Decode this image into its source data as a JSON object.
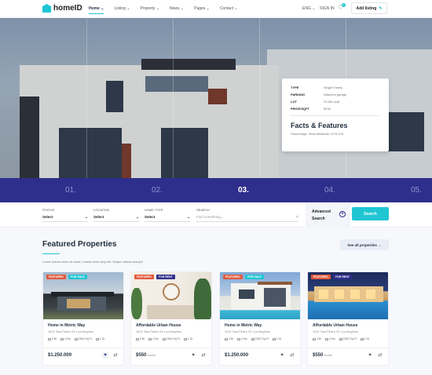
{
  "header": {
    "logo": "homeID",
    "nav": [
      {
        "label": "Home ⌄",
        "active": true
      },
      {
        "label": "Listing ⌄"
      },
      {
        "label": "Property ⌄"
      },
      {
        "label": "News ⌄"
      },
      {
        "label": "Pages ⌄"
      },
      {
        "label": "Contact ⌄"
      }
    ],
    "lang": "ENG ⌄",
    "signin": "SIGN IN",
    "wishlist_count": "0",
    "add_listing": "Add listing"
  },
  "facts": {
    "rows": [
      {
        "label": "TYPE",
        "value": "Single Family"
      },
      {
        "label": "PARKING",
        "value": "Attached garage"
      },
      {
        "label": "LOT",
        "value": "23,581 sqft"
      },
      {
        "label": "PRICE/SQFT",
        "value": "$106"
      }
    ],
    "title": "Facts & Features",
    "address": "Stourbridge, West Midlands, DY8 1FA"
  },
  "slider": {
    "numbers": [
      "01.",
      "02.",
      "03.",
      "04.",
      "05."
    ],
    "active_index": 2
  },
  "search": {
    "status_label": "STATUS",
    "status_value": "Select",
    "location_label": "LOCATION",
    "location_value": "Select",
    "type_label": "HOME TYPE",
    "type_value": "Select",
    "search_label": "SEARCH",
    "search_placeholder": "Find something...",
    "advanced": "Advanced Search",
    "button": "Search"
  },
  "featured": {
    "title": "Featured Properties",
    "subtitle": "Lorem ipsum dolor sit amet, consec tetur cing elit. Suspe ndisse suscipit",
    "see_all": "See all properties →",
    "cards": [
      {
        "tags": [
          "FEATURED",
          "FOR SALE"
        ],
        "name": "Home in Metric Way",
        "address": "1421 San Pedro St, Los Angeles",
        "beds": "3 Br",
        "baths": "3 Ba",
        "area": "2300 Sq.Ft",
        "garage": "1 Gr",
        "price": "$1.250.000",
        "unit": "",
        "liked": true
      },
      {
        "tags": [
          "FEATURED",
          "FOR RENT"
        ],
        "name": "Affordable Urban House",
        "address": "1421 San Pedro St, Los Angeles",
        "beds": "3 Br",
        "baths": "3 Ba",
        "area": "2300 Sq.Ft",
        "garage": "1 Gr",
        "price": "$550",
        "unit": "/month",
        "liked": false
      },
      {
        "tags": [
          "FEATURED",
          "FOR SALE"
        ],
        "name": "Home in Metric Way",
        "address": "1421 San Pedro St, Los Angeles",
        "beds": "3 Br",
        "baths": "3 Ba",
        "area": "2300 Sq.Ft",
        "garage": "1 Gr",
        "price": "$1.250.000",
        "unit": "",
        "liked": false
      },
      {
        "tags": [
          "FEATURED",
          "FOR RENT"
        ],
        "name": "Affordable Urban House",
        "address": "1421 San Pedro St, Los Angeles",
        "beds": "3 Br",
        "baths": "3 Ba",
        "area": "2300 Sq.Ft",
        "garage": "1 Gr",
        "price": "$550",
        "unit": "/month",
        "liked": false
      }
    ]
  },
  "colors": {
    "accent": "#1fc6d2",
    "primary": "#2e2e8c",
    "featured_tag": "#e2593b"
  }
}
